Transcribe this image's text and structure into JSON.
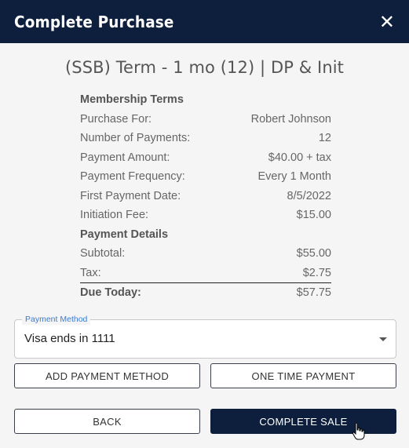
{
  "dialog": {
    "title": "Complete Purchase",
    "close_icon": "close-icon"
  },
  "plan_title": "(SSB) Term - 1 mo (12) | DP & Init",
  "membership_terms": {
    "heading": "Membership Terms",
    "rows": [
      {
        "label": "Purchase For:",
        "value": "Robert Johnson"
      },
      {
        "label": "Number of Payments:",
        "value": "12"
      },
      {
        "label": "Payment Amount:",
        "value": "$40.00 + tax"
      },
      {
        "label": "Payment Frequency:",
        "value": "Every 1 Month"
      },
      {
        "label": "First Payment Date:",
        "value": "8/5/2022"
      },
      {
        "label": "Initiation Fee:",
        "value": "$15.00"
      }
    ]
  },
  "payment_details": {
    "heading": "Payment Details",
    "rows": [
      {
        "label": "Subtotal:",
        "value": "$55.00"
      },
      {
        "label": "Tax:",
        "value": "$2.75"
      }
    ],
    "total": {
      "label": "Due Today:",
      "value": "$57.75"
    }
  },
  "payment_method": {
    "label": "Payment Method",
    "selected": "Visa ends in 1111"
  },
  "buttons": {
    "add_payment_method": "ADD PAYMENT METHOD",
    "one_time_payment": "ONE TIME PAYMENT",
    "back": "BACK",
    "complete_sale": "COMPLETE SALE"
  },
  "colors": {
    "header": "#0d1f3c",
    "primary_button": "#0d1f3c",
    "field_label": "#3a7bd5"
  }
}
